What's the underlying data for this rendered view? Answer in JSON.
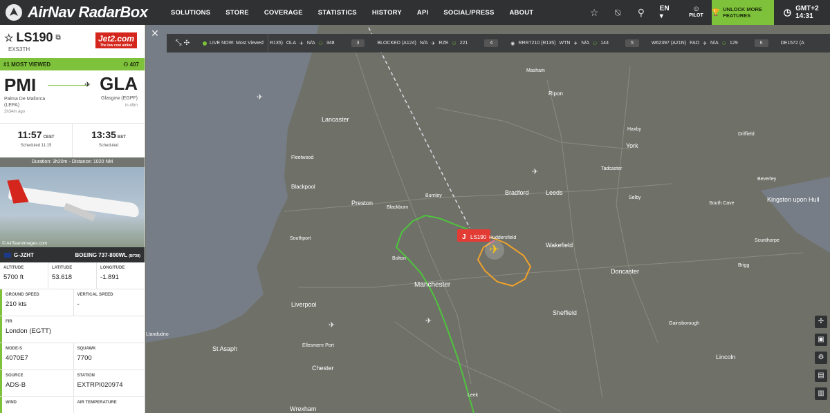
{
  "app": {
    "title": "AirNav RadarBox"
  },
  "nav": {
    "items": [
      "SOLUTIONS",
      "STORE",
      "COVERAGE",
      "STATISTICS",
      "HISTORY",
      "API",
      "SOCIAL/PRESS",
      "ABOUT"
    ]
  },
  "header": {
    "lang": "EN",
    "pilot": "PILOT",
    "unlock": "UNLOCK MORE FEATURES",
    "clock": "GMT+2 14:31"
  },
  "flight": {
    "number": "LS190",
    "callsign": "EXS3TH",
    "airline_logo": "Jet2.com",
    "airline_tagline": "The low cost airline",
    "most_viewed_label": "#1 MOST VIEWED",
    "views": "407",
    "origin": {
      "iata": "PMI",
      "name": "Palma De Mallorca",
      "icao": "(LEPA)",
      "ago": "2h34m ago"
    },
    "destination": {
      "iata": "GLA",
      "name": "Glasgow (EGPF)",
      "eta": "in 45m"
    },
    "dep_time": "11:57",
    "dep_tz": "CEST",
    "dep_sub": "Scheduled 11:15",
    "arr_time": "13:35",
    "arr_tz": "BST",
    "arr_sub": "Scheduled",
    "duration": "Duration: 3h20m - Distance: 1020 NM",
    "photo_credit": "© AirTeamImages.com",
    "registration": "G-JZHT",
    "aircraft": "BOEING 737-800WL",
    "aircraft_code": "(B738)"
  },
  "details": {
    "altitude": {
      "label": "ALTITUDE",
      "value": "5700 ft"
    },
    "latitude": {
      "label": "LATITUDE",
      "value": "53.618"
    },
    "longitude": {
      "label": "LONGITUDE",
      "value": "-1.891"
    },
    "ground_speed": {
      "label": "GROUND SPEED",
      "value": "210 kts"
    },
    "vertical_speed": {
      "label": "VERTICAL SPEED",
      "value": "-"
    },
    "fir": {
      "label": "FIR",
      "value": "London (EGTT)"
    },
    "mode_s": {
      "label": "MODE-S",
      "value": "4070E7"
    },
    "squawk": {
      "label": "SQUAWK",
      "value": "7700"
    },
    "source": {
      "label": "SOURCE",
      "value": "ADS-B"
    },
    "station": {
      "label": "STATION",
      "value": "EXTRPI020974"
    },
    "wind": {
      "label": "WIND"
    },
    "air_temperature": {
      "label": "AIR TEMPERATURE"
    }
  },
  "ticker": {
    "live": "LIVE NOW: Most Viewed",
    "entries": [
      {
        "flight": "R135)",
        "from": "OLA",
        "to": "N/A",
        "views": "348",
        "rank": "3"
      },
      {
        "flight": "BLOCKED (A124)",
        "from": "N/A",
        "to": "RZE",
        "views": "221",
        "rank": "4"
      },
      {
        "flight": "RRR7210 (R135)",
        "from": "WTN",
        "to": "N/A",
        "views": "144",
        "rank": "5"
      },
      {
        "flight": "W62397 (A21N)",
        "from": "FAO",
        "to": "N/A",
        "views": "129",
        "rank": "6"
      },
      {
        "flight": "DE1572 (A",
        "from": "",
        "to": "",
        "views": "",
        "rank": ""
      }
    ]
  },
  "map": {
    "flight_tag": "LS190",
    "places": [
      "Lancaster",
      "Fleetwood",
      "Blackpool",
      "Preston",
      "Blackburn",
      "Burnley",
      "Bradford",
      "Leeds",
      "Wakefield",
      "Huddersfield",
      "Bolton",
      "Manchester",
      "Southport",
      "Liverpool",
      "Sheffield",
      "Doncaster",
      "Ripon",
      "York",
      "Haxby",
      "Tadcaster",
      "Selby",
      "Driffield",
      "Beverley",
      "Kingston upon Hull",
      "South Cave",
      "Brigg",
      "Lincoln",
      "Chester",
      "St Asaph",
      "Ellesmere Port",
      "Wrexham",
      "Leek",
      "Masham",
      "Scunthorpe",
      "Gainsborough",
      "Llandudno"
    ]
  },
  "colors": {
    "accent": "#7ec23b",
    "topbar": "#2f3133",
    "flag_red": "#e23c35"
  }
}
